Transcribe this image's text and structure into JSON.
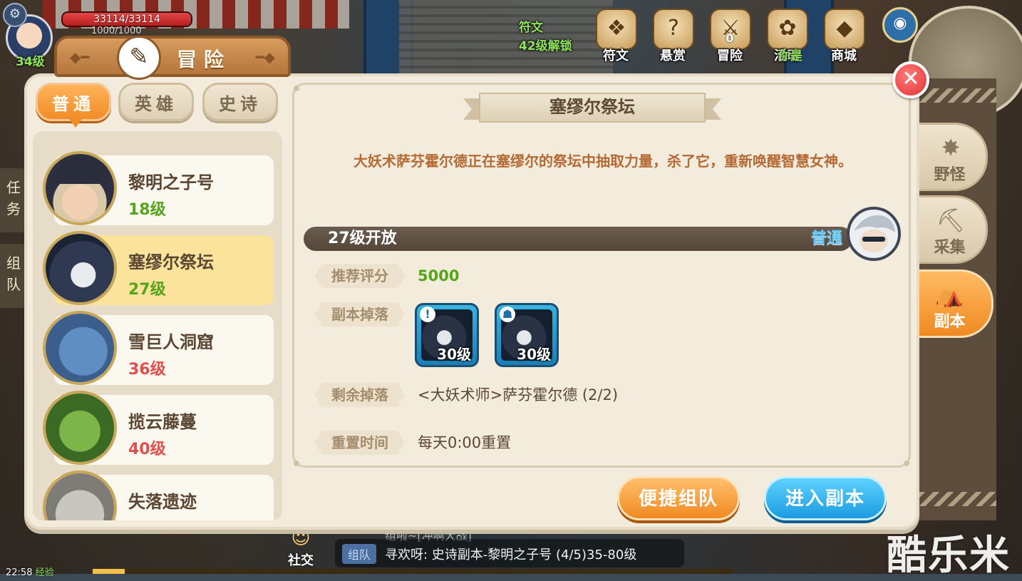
{
  "hud": {
    "player_level": "34级",
    "hp_text": "33114/33114",
    "hp_fraction": 1.0,
    "mp_text": "1000/1000",
    "rune_unlock_title": "符文",
    "rune_unlock_text": "42级解锁",
    "top_icons": [
      {
        "label": "符文",
        "icon": "rune-icon",
        "glyph": "❖"
      },
      {
        "label": "悬赏",
        "icon": "bounty-icon",
        "glyph": "?"
      },
      {
        "label": "冒险",
        "icon": "adventure-icon",
        "glyph": "⚔",
        "count": "0"
      },
      {
        "label": "活动",
        "icon": "event-icon",
        "glyph": "✿"
      },
      {
        "label": "商城",
        "icon": "shop-icon",
        "glyph": "◆"
      }
    ],
    "ticker_text": "你是",
    "left_tabs": [
      "任务",
      "组队"
    ],
    "chat_header": "组啦~[冲啊大战]",
    "chat_tag": "组队",
    "chat_message": "寻欢呀: 史诗副本-黎明之子号 (4/5)35-80级",
    "social_label": "社交",
    "clock": "22:58",
    "exp_label": "经验",
    "exp_percent": 5,
    "watermark": "酷乐米"
  },
  "panel": {
    "title": "冒险",
    "difficulty_tabs": [
      {
        "label": "普通",
        "active": true
      },
      {
        "label": "英雄",
        "active": false
      },
      {
        "label": "史诗",
        "active": false
      }
    ],
    "dungeons": [
      {
        "name": "黎明之子号",
        "level": "18级",
        "level_color": "#55a51a",
        "selected": false,
        "portrait": "pirate-captain-portrait"
      },
      {
        "name": "塞缪尔祭坛",
        "level": "27级",
        "level_color": "#55a51a",
        "selected": true,
        "portrait": "dark-dragon-portrait"
      },
      {
        "name": "雪巨人洞窟",
        "level": "36级",
        "level_color": "#e0504e",
        "selected": false,
        "portrait": "snow-giant-portrait"
      },
      {
        "name": "揽云藤蔓",
        "level": "40级",
        "level_color": "#e0504e",
        "selected": false,
        "portrait": "vine-monster-portrait"
      },
      {
        "name": "失落遗迹",
        "level": "",
        "level_color": "#e0504e",
        "selected": false,
        "portrait": "rock-golem-portrait"
      }
    ],
    "detail": {
      "title": "塞缪尔祭坛",
      "description": "大妖术萨芬霍尔德正在塞缪尔的祭坛中抽取力量，杀了它，重新唤醒智慧女神。",
      "open_level": "27级开放",
      "mode": "普通",
      "rows": {
        "recommended_label": "推荐评分",
        "recommended_value": "5000",
        "drops_label": "副本掉落",
        "remaining_label": "剩余掉落",
        "remaining_value": "<大妖术师>萨芬霍尔德 (2/2)",
        "reset_label": "重置时间",
        "reset_value": "每天0:00重置"
      },
      "drops": [
        {
          "level": "30级",
          "tag": "!"
        },
        {
          "level": "30级",
          "tag": "☗"
        }
      ]
    },
    "buttons": {
      "quick_team": "便捷组队",
      "enter_dungeon": "进入副本"
    },
    "side_tabs": [
      {
        "label": "野怪",
        "icon": "wild-monster-icon",
        "glyph": "✸",
        "active": false
      },
      {
        "label": "采集",
        "icon": "gather-icon",
        "glyph": "⛏",
        "active": false
      },
      {
        "label": "副本",
        "icon": "dungeon-icon",
        "glyph": "⛺",
        "active": true
      }
    ],
    "close_glyph": "✕"
  }
}
